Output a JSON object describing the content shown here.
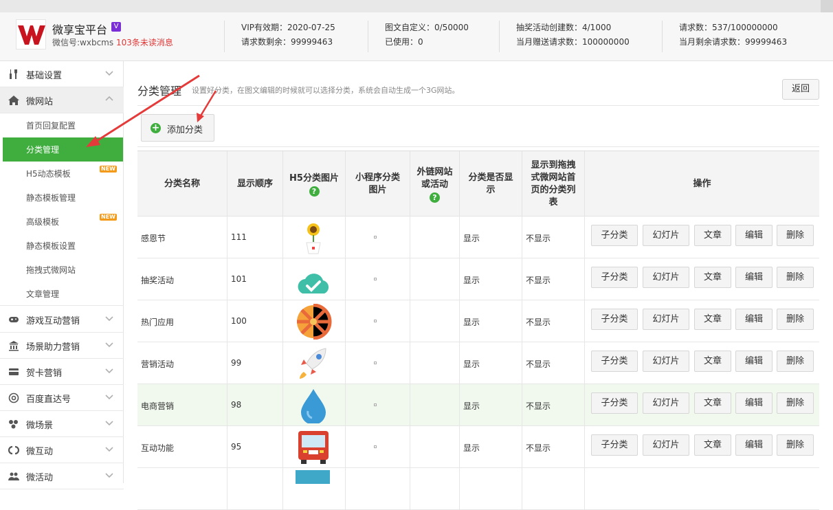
{
  "header": {
    "site_name": "微享宝平台",
    "vip_icon": "V",
    "wechat_id": "微信号:wxbcms",
    "unread": "103条未读消息",
    "stats": [
      [
        "VIP有效期：2020-07-25",
        "请求数剩余：99999463"
      ],
      [
        "图文自定义：0/50000",
        "已使用：0"
      ],
      [
        "抽奖活动创建数：4/1000",
        "当月赠送请求数：100000000"
      ],
      [
        "请求数：537/100000000",
        "当月剩余请求数：99999463"
      ]
    ]
  },
  "sidebar": {
    "groups": [
      {
        "label": "基础设置",
        "icon": "wrench-icon"
      },
      {
        "label": "微网站",
        "icon": "home-icon"
      }
    ],
    "sub_items": [
      {
        "label": "首页回复配置"
      },
      {
        "label": "分类管理"
      },
      {
        "label": "H5动态模板",
        "badge": "NEW"
      },
      {
        "label": "静态模板管理"
      },
      {
        "label": "高级模板",
        "badge": "NEW"
      },
      {
        "label": "静态模板设置"
      },
      {
        "label": "拖拽式微网站"
      },
      {
        "label": "文章管理"
      }
    ],
    "lower_groups": [
      {
        "label": "游戏互动营销",
        "icon": "gamepad-icon"
      },
      {
        "label": "场景助力营销",
        "icon": "bank-icon"
      },
      {
        "label": "贺卡营销",
        "icon": "card-icon"
      },
      {
        "label": "百度直达号",
        "icon": "at-icon"
      },
      {
        "label": "微场景",
        "icon": "scene-icon"
      },
      {
        "label": "微互动",
        "icon": "link-icon"
      },
      {
        "label": "微活动",
        "icon": "people-icon"
      }
    ]
  },
  "page": {
    "title": "分类管理",
    "desc": "设置好分类，在图文编辑的时候就可以选择分类，系统会自动生成一个3G网站。",
    "back": "返回",
    "add": "添加分类"
  },
  "table": {
    "headers": {
      "name": "分类名称",
      "order": "显示顺序",
      "h5_img": "H5分类图片",
      "mini_img_1": "小程序分类",
      "mini_img_2": "图片",
      "ext_1": "外链网站",
      "ext_2": "或活动",
      "show_1": "分类是否显",
      "show_2": "示",
      "home_1": "显示到拖拽",
      "home_2": "式微网站首",
      "home_3": "页的分类列",
      "home_4": "表",
      "ops": "操作",
      "help": "?"
    },
    "rows": [
      {
        "name": "感恩节",
        "order": "111",
        "img": "sunflower-icon",
        "show": "显示",
        "home": "不显示"
      },
      {
        "name": "抽奖活动",
        "order": "101",
        "img": "cloud-check-icon",
        "show": "显示",
        "home": "不显示"
      },
      {
        "name": "热门应用",
        "order": "100",
        "img": "lollipop-icon",
        "show": "显示",
        "home": "不显示"
      },
      {
        "name": "营销活动",
        "order": "99",
        "img": "rocket-icon",
        "show": "显示",
        "home": "不显示"
      },
      {
        "name": "电商营销",
        "order": "98",
        "img": "water-drop-icon",
        "show": "显示",
        "home": "不显示"
      },
      {
        "name": "互动功能",
        "order": "95",
        "img": "bus-icon",
        "show": "显示",
        "home": "不显示"
      }
    ],
    "ops": [
      "子分类",
      "幻灯片",
      "文章",
      "编辑",
      "删除"
    ]
  },
  "colors": {
    "accent": "#3fae3f",
    "unread": "#e23636",
    "annotation": "#e53a3a"
  }
}
